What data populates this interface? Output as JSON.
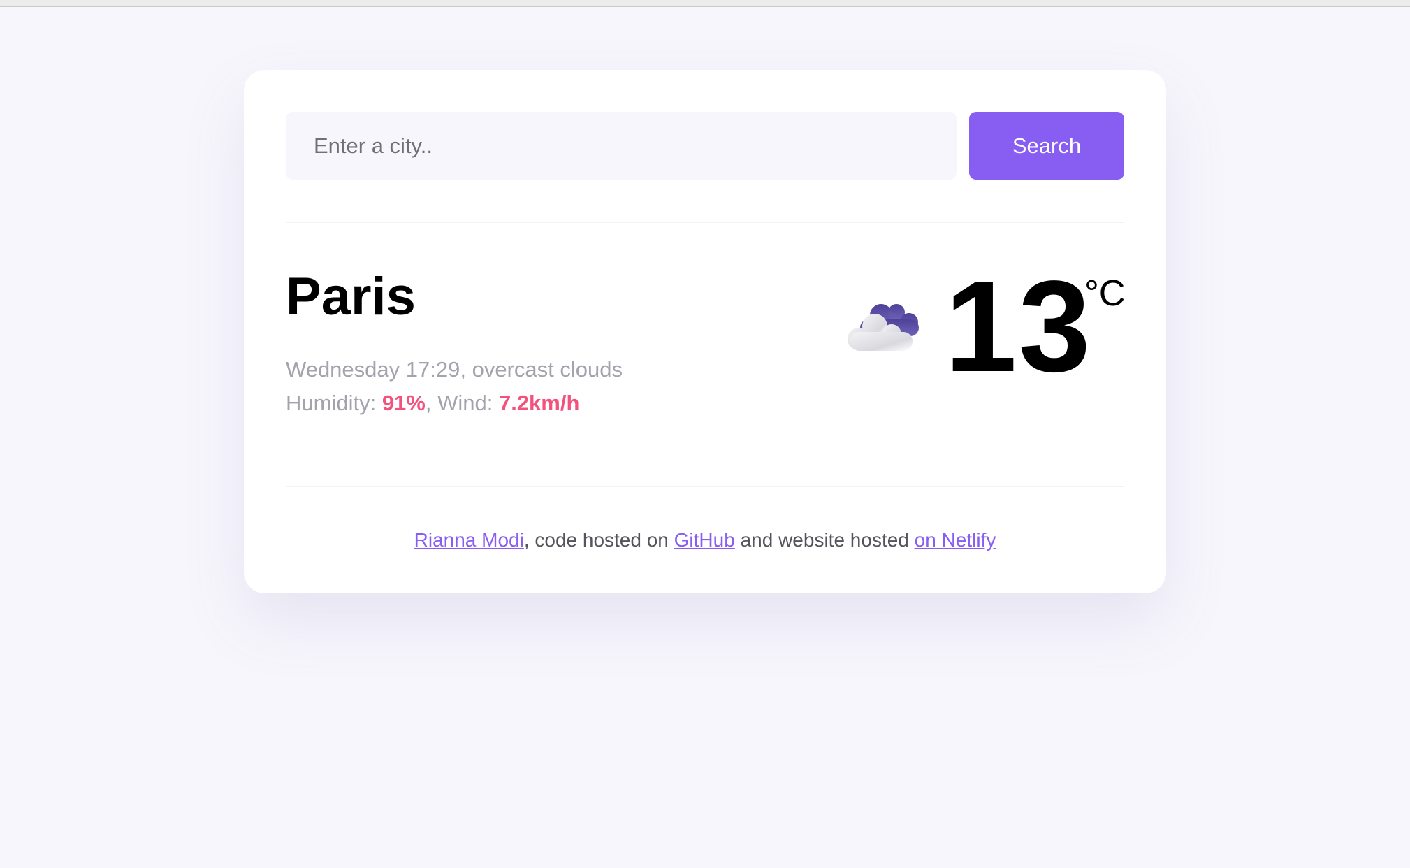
{
  "search": {
    "placeholder": "Enter a city..",
    "value": "",
    "button_label": "Search"
  },
  "weather": {
    "city": "Paris",
    "day_time": "Wednesday 17:29",
    "description": "overcast clouds",
    "humidity_label": "Humidity: ",
    "humidity": "91%",
    "wind_label": "Wind: ",
    "wind": "7.2km/h",
    "separator": ", ",
    "temperature": "13",
    "unit": "°C",
    "icon": "overcast-clouds-icon"
  },
  "footer": {
    "author_link": "Rianna Modi",
    "text_code": ", code hosted on ",
    "github_link": "GitHub",
    "text_website": " and website hosted ",
    "netlify_link": "on Netlify"
  },
  "colors": {
    "accent": "#885df1",
    "highlight": "#f2527c",
    "background": "#f7f6fc",
    "muted_text": "#a4a3ad"
  }
}
